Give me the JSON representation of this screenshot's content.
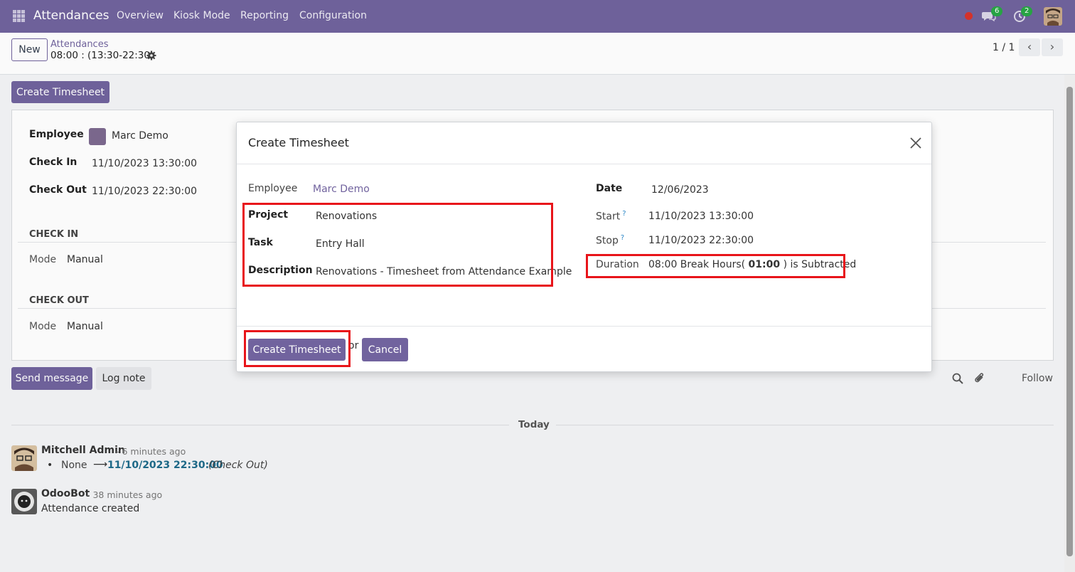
{
  "navbar": {
    "app_title": "Attendances",
    "menu": [
      "Overview",
      "Kiosk Mode",
      "Reporting",
      "Configuration"
    ],
    "chat_badge": "6",
    "activity_badge": "2"
  },
  "control_panel": {
    "new_label": "New",
    "breadcrumb_parent": "Attendances",
    "breadcrumb_current": "08:00 : (13:30-22:30)",
    "pager": "1 / 1"
  },
  "background_form": {
    "create_timesheet_label": "Create Timesheet",
    "employee_label": "Employee",
    "employee_value": "Marc Demo",
    "check_in_label": "Check In",
    "check_in_value": "11/10/2023 13:30:00",
    "check_out_label": "Check Out",
    "check_out_value": "11/10/2023 22:30:00",
    "check_in_section": "CHECK IN",
    "check_out_section": "CHECK OUT",
    "mode_label": "Mode",
    "mode_in_value": "Manual",
    "mode_out_value": "Manual"
  },
  "chatter": {
    "send_message_label": "Send message",
    "log_note_label": "Log note",
    "follow_label": "Follow",
    "today_label": "Today",
    "messages": [
      {
        "author": "Mitchell Admin",
        "time": "- 6 minutes ago",
        "old_value": "None",
        "arrow": "⟶",
        "new_value": "11/10/2023 22:30:00",
        "field": "(Check Out)"
      },
      {
        "author": "OdooBot",
        "time": "- 38 minutes ago",
        "body": "Attendance created"
      }
    ]
  },
  "modal": {
    "title": "Create Timesheet",
    "employee_label": "Employee",
    "employee_value": "Marc Demo",
    "project_label": "Project",
    "project_value": "Renovations",
    "task_label": "Task",
    "task_value": "Entry Hall",
    "description_label": "Description",
    "description_value": "Renovations - Timesheet from Attendance Example",
    "date_label": "Date",
    "date_value": "12/06/2023",
    "start_label": "Start",
    "start_value": "11/10/2023 13:30:00",
    "stop_label": "Stop",
    "stop_value": "11/10/2023 22:30:00",
    "help_mark": "?",
    "duration_label": "Duration",
    "duration_prefix": "08:00 Break Hours(",
    "duration_break": "01:00",
    "duration_suffix": ") is Subtracted",
    "create_label": "Create Timesheet",
    "or_label": "or",
    "cancel_label": "Cancel"
  },
  "colors": {
    "brand": "#71639e",
    "highlight": "#e8141a",
    "badge": "#28a745"
  }
}
